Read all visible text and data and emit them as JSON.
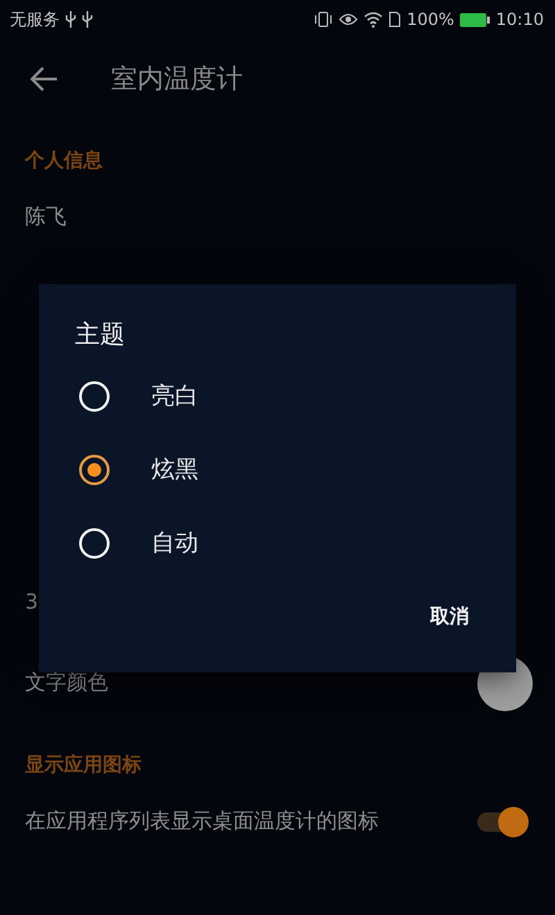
{
  "status_bar": {
    "carrier": "无服务",
    "battery_text": "100%",
    "time": "10:10"
  },
  "toolbar": {
    "title": "室内温度计"
  },
  "settings": [
    {
      "kind": "header",
      "text": "个人信息"
    },
    {
      "kind": "item",
      "text": "陈飞"
    },
    {
      "kind": "header"
    },
    {
      "kind": "item"
    },
    {
      "kind": "item"
    },
    {
      "kind": "header"
    },
    {
      "kind": "two_line",
      "summary": "3"
    },
    {
      "kind": "color",
      "text": "文字颜色",
      "color": "#9e9e9e"
    },
    {
      "kind": "header",
      "text": "显示应用图标"
    },
    {
      "kind": "switch",
      "text": "在应用程序列表显示桌面温度计的图标",
      "on": true
    }
  ],
  "dialog": {
    "title": "主题",
    "options": [
      {
        "label": "亮白",
        "selected": false
      },
      {
        "label": "炫黑",
        "selected": true
      },
      {
        "label": "自动",
        "selected": false
      }
    ],
    "buttons": [
      "取消"
    ]
  }
}
